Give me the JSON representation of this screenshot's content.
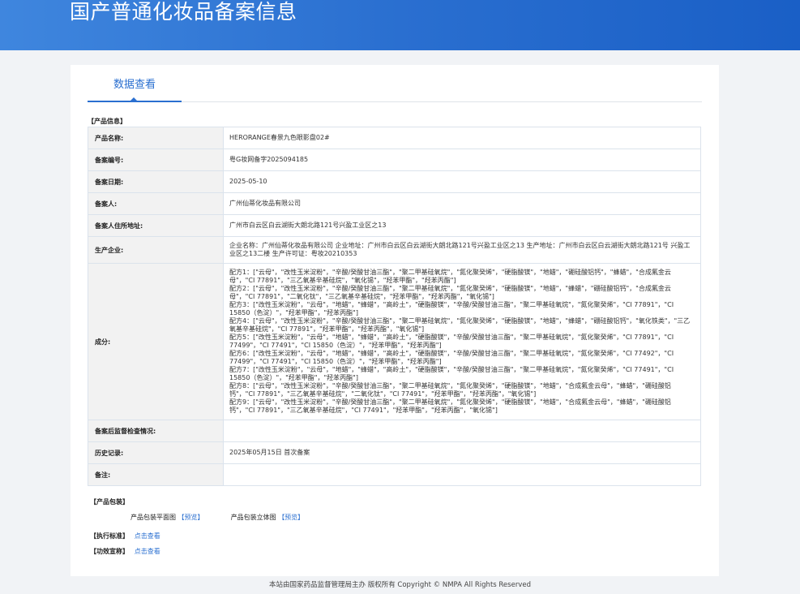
{
  "header": {
    "title": "国产普通化妆品备案信息"
  },
  "tabs": [
    {
      "label": "数据查看"
    }
  ],
  "product_info": {
    "section_title": "【产品信息】",
    "rows": [
      {
        "label": "产品名称:",
        "value": "HERORANGE春景九色眼影盘02#"
      },
      {
        "label": "备案编号:",
        "value": "粤G妆网备字2025094185"
      },
      {
        "label": "备案日期:",
        "value": "2025-05-10"
      },
      {
        "label": "备案人:",
        "value": "广州仙蒂化妆品有限公司"
      },
      {
        "label": "备案人住所地址:",
        "value": "广州市白云区白云湖街大朗北路121号兴盈工业区之13"
      },
      {
        "label": "生产企业:",
        "value": "企业名称：广州仙蒂化妆品有限公司 企业地址：广州市白云区白云湖街大朗北路121号兴盈工业区之13 生产地址：广州市白云区白云湖街大朗北路121号 兴盈工业区之13二楼 生产许可证：粤妆20210353"
      }
    ],
    "ingredients_label": "成分:",
    "ingredients": [
      "配方1：[\"云母\"，\"改性玉米淀粉\"，\"辛酸/癸酸甘油三酯\"，\"聚二甲基硅氧烷\"，\"氮化聚癸烯\"，\"硬脂酸镁\"，\"地蜡\"，\"硼硅酸铝钙\"，\"蜂蜡\"，\"合成氟金云母\"，\"CI 77891\"，\"三乙氧基辛基硅烷\"，\"氧化锡\"，\"羟苯甲酯\"，\"羟苯丙酯\"]",
      "配方2：[\"云母\"，\"改性玉米淀粉\"，\"辛酸/癸酸甘油三酯\"，\"聚二甲基硅氧烷\"，\"氮化聚癸烯\"，\"硬脂酸镁\"，\"地蜡\"，\"蜂蜡\"，\"硼硅酸铝钙\"，\"合成氟金云母\"，\"CI 77891\"，\"二氧化钛\"，\"三乙氧基辛基硅烷\"，\"羟苯甲酯\"，\"羟苯丙酯\"，\"氧化锡\"]",
      "配方3：[\"改性玉米淀粉\"，\"云母\"，\"地蜡\"，\"蜂蜡\"，\"高岭土\"，\"硬脂酸镁\"，\"辛酸/癸酸甘油三酯\"，\"聚二甲基硅氧烷\"，\"氮化聚癸烯\"，\"CI 77891\"，\"CI 15850（色淀）\"，\"羟苯甲酯\"，\"羟苯丙酯\"]",
      "配方4：[\"云母\"，\"改性玉米淀粉\"，\"辛酸/癸酸甘油三酯\"，\"聚二甲基硅氧烷\"，\"氮化聚癸烯\"，\"硬脂酸镁\"，\"地蜡\"，\"蜂蜡\"，\"硼硅酸铝钙\"，\"氧化铁类\"，\"三乙氧基辛基硅烷\"，\"CI 77891\"，\"羟苯甲酯\"，\"羟苯丙酯\"，\"氧化锡\"]",
      "配方5：[\"改性玉米淀粉\"，\"云母\"，\"地蜡\"，\"蜂蜡\"，\"高岭土\"，\"硬脂酸镁\"，\"辛酸/癸酸甘油三酯\"，\"聚二甲基硅氧烷\"，\"氮化聚癸烯\"，\"CI 77891\"，\"CI 77499\"，\"CI 77491\"，\"CI 15850（色淀）\"，\"羟苯甲酯\"，\"羟苯丙酯\"]",
      "配方6：[\"改性玉米淀粉\"，\"云母\"，\"地蜡\"，\"蜂蜡\"，\"高岭土\"，\"硬脂酸镁\"，\"辛酸/癸酸甘油三酯\"，\"聚二甲基硅氧烷\"，\"氮化聚癸烯\"，\"CI 77492\"，\"CI 77499\"，\"CI 77491\"，\"CI 15850（色淀）\"，\"羟苯甲酯\"，\"羟苯丙酯\"]",
      "配方7：[\"改性玉米淀粉\"，\"云母\"，\"地蜡\"，\"蜂蜡\"，\"高岭土\"，\"硬脂酸镁\"，\"辛酸/癸酸甘油三酯\"，\"聚二甲基硅氧烷\"，\"氮化聚癸烯\"，\"CI 77491\"，\"CI 15850（色淀）\"，\"羟苯甲酯\"，\"羟苯丙酯\"]",
      "配方8：[\"云母\"，\"改性玉米淀粉\"，\"辛酸/癸酸甘油三酯\"，\"聚二甲基硅氧烷\"，\"氮化聚癸烯\"，\"硬脂酸镁\"，\"地蜡\"，\"合成氟金云母\"，\"蜂蜡\"，\"硼硅酸铝钙\"，\"CI 77891\"，\"三乙氧基辛基硅烷\"，\"二氧化钛\"，\"CI 77491\"，\"羟苯甲酯\"，\"羟苯丙酯\"，\"氧化锡\"]",
      "配方9：[\"云母\"，\"改性玉米淀粉\"，\"辛酸/癸酸甘油三酯\"，\"聚二甲基硅氧烷\"，\"氮化聚癸烯\"，\"硬脂酸镁\"，\"地蜡\"，\"合成氟金云母\"，\"蜂蜡\"，\"硼硅酸铝钙\"，\"CI 77891\"，\"三乙氧基辛基硅烷\"，\"CI 77491\"，\"羟苯甲酯\"，\"羟苯丙酯\"，\"氧化锡\"]"
    ],
    "tail_rows": [
      {
        "label": "备案后监督检查情况:",
        "value": ""
      },
      {
        "label": "历史记录:",
        "value": "2025年05月15日 首次备案"
      },
      {
        "label": "备注:",
        "value": ""
      }
    ]
  },
  "packaging": {
    "section_title": "【产品包装】",
    "flat_label": "产品包装平面图",
    "flat_link": "【预览】",
    "solid_label": "产品包装立体图",
    "solid_link": "【预览】"
  },
  "standards": {
    "section_title": "【执行标准】",
    "link": "点击查看"
  },
  "claims": {
    "section_title": "【功效宣称】",
    "link": "点击查看"
  },
  "footer": {
    "text": "本站由国家药品监督管理局主办 版权所有 Copyright © NMPA All Rights Reserved"
  },
  "colors": {
    "banner": "#2a6fd0",
    "accent": "#2a6fd0",
    "label_bg": "#f2f2f2"
  }
}
